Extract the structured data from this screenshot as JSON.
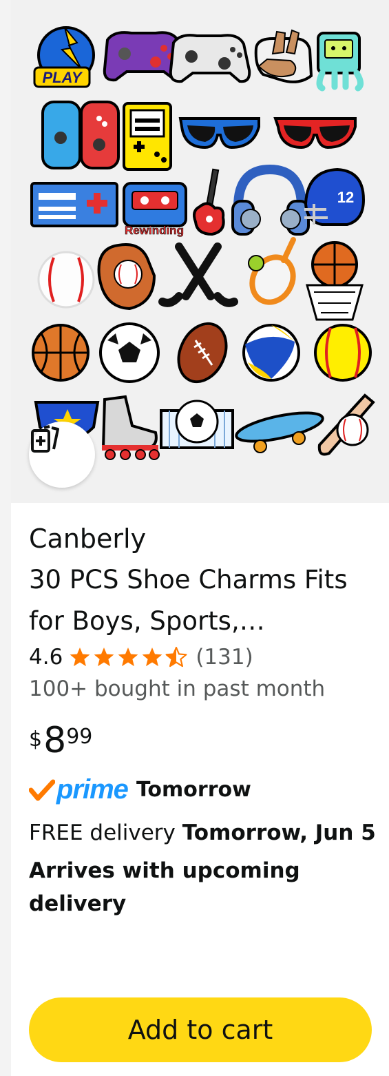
{
  "product": {
    "brand": "Canberly",
    "title_line1": "30 PCS Shoe Charms Fits",
    "title_line2": "for Boys, Sports,…",
    "rating": "4.6",
    "stars": 4.6,
    "review_count": "(131)",
    "bought": "100+ bought in past month",
    "price_symbol": "$",
    "price_whole": "8",
    "price_fraction": "99",
    "prime_label": "prime",
    "prime_day": "Tomorrow",
    "delivery_prefix": "FREE delivery ",
    "delivery_date": "Tomorrow, Jun 5",
    "upcoming": "Arrives with upcoming delivery",
    "image_text": {
      "play": "PLAY",
      "rewinding": "Rewinding",
      "helmet_number": "12"
    }
  },
  "actions": {
    "add_to_cart": "Add to cart",
    "compare_icon": "add-compare-icon"
  },
  "colors": {
    "star": "#ff7a00",
    "prime": "#1a98ff",
    "check": "#ff7a00",
    "cart_button": "#ffd814"
  }
}
